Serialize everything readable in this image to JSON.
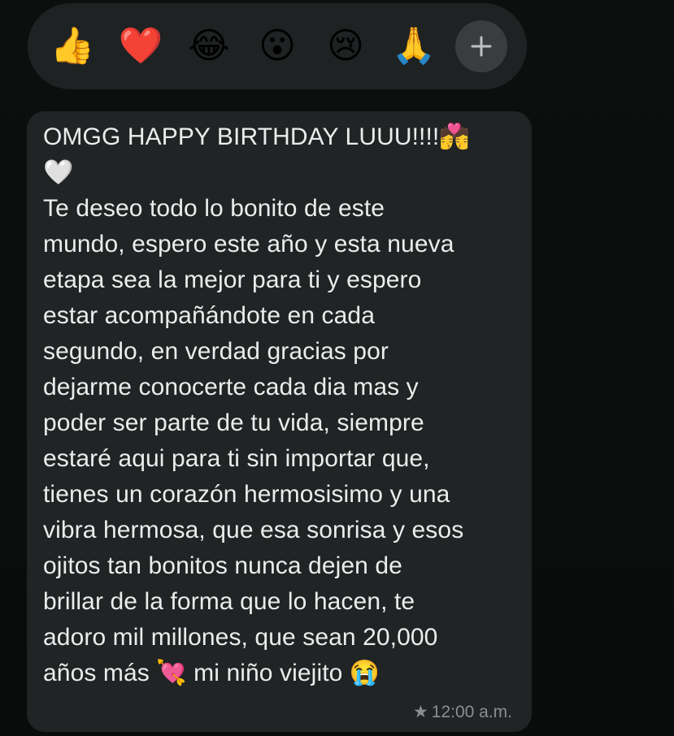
{
  "reactions": [
    {
      "emoji": "👍",
      "name": "thumbs-up"
    },
    {
      "emoji": "❤️",
      "name": "red-heart"
    },
    {
      "emoji": "😂",
      "name": "tears-of-joy"
    },
    {
      "emoji": "😮",
      "name": "open-mouth"
    },
    {
      "emoji": "😢",
      "name": "crying-face"
    },
    {
      "emoji": "🙏",
      "name": "folded-hands"
    }
  ],
  "reaction_more_icon": "plus-icon",
  "message": {
    "text": "OMGG HAPPY BIRTHDAY LUUU!!!!💏\n🤍\nTe deseo todo lo bonito de este\nmundo, espero este año y esta nueva\netapa sea la mejor para ti y espero\nestar acompañándote en cada\nsegundo, en verdad gracias por\ndejarme conocerte cada dia mas y\npoder ser parte de tu vida, siempre\nestaré aqui para ti sin importar que,\ntienes un corazón hermosisimo y una\nvibra hermosa, que esa sonrisa y esos\nojitos tan bonitos nunca dejen de\nbrillar de la forma que lo hacen, te\nadoro mil millones, que sean 20,000\naños más 💘 mi niño viejito 😭",
    "starred_icon": "★",
    "time": "12:00 a.m."
  },
  "colors": {
    "background": "#0b0c0c",
    "reaction_bar": "#1f2223",
    "bubble": "#202425",
    "text": "#ececec",
    "meta": "#8a8e90"
  }
}
